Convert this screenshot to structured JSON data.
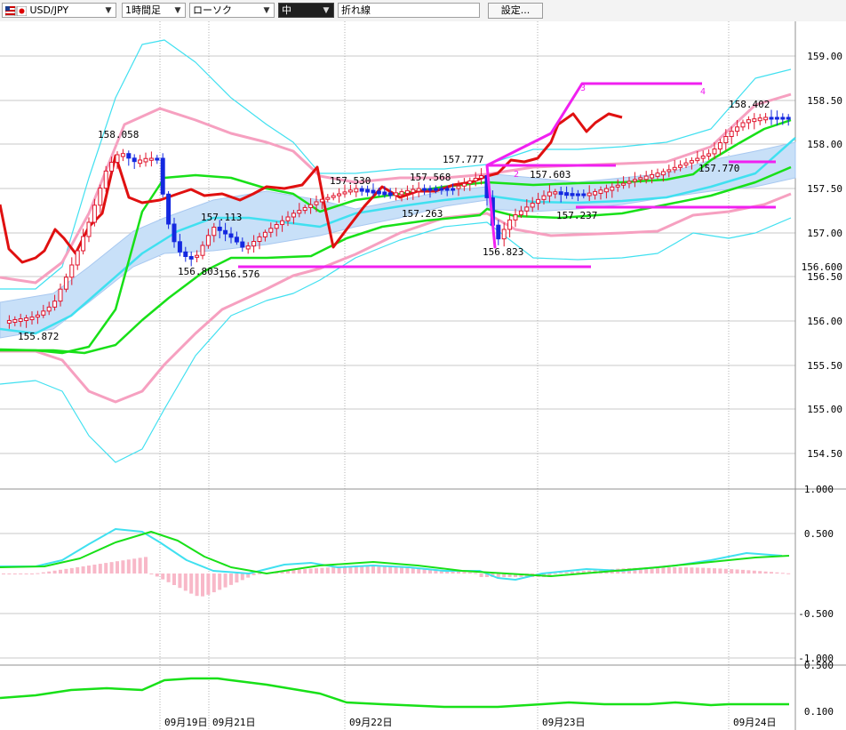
{
  "toolbar": {
    "symbol": "USD/JPY",
    "timeframe": "1時間足",
    "chart_style": "ローソク",
    "size": "中",
    "line_type": "折れ線",
    "settings_label": "設定..."
  },
  "colors": {
    "bg": "#ffffff",
    "grid_solid": "#c8c8c8",
    "grid_dotted": "#b0b0b0",
    "candle_up": "#e0142c",
    "candle_down": "#1428e0",
    "bb_outer": "#40e0f0",
    "bb_inner": "#f6a0c0",
    "ma_green": "#18e018",
    "cloud": "#c8e0f8",
    "red_line": "#e01010",
    "magenta": "#f020f0",
    "histogram": "#f8b8c8"
  },
  "price_axis": {
    "ticks": [
      "159.00",
      "158.50",
      "158.00",
      "157.50",
      "157.00",
      "156.600",
      "156.50",
      "156.00",
      "155.50",
      "155.00",
      "154.50"
    ]
  },
  "macd_axis": {
    "ticks": [
      "1.000",
      "0.500",
      "-0.500",
      "-1.000"
    ]
  },
  "adx_axis": {
    "ticks": [
      "0.500",
      "0.100"
    ]
  },
  "date_labels": [
    "09月19日",
    "09月21日",
    "09月22日",
    "09月23日",
    "09月24日"
  ],
  "price_labels": [
    "158.058",
    "155.872",
    "157.113",
    "156.803",
    "156.576",
    "157.530",
    "157.568",
    "157.263",
    "157.777",
    "156.823",
    "157.603",
    "157.237",
    "158.402",
    "157.770"
  ],
  "wave_labels": [
    "2",
    "3",
    "4"
  ],
  "chart_data": {
    "type": "candlestick",
    "symbol": "USD/JPY",
    "timeframe": "1時間足",
    "ylim": [
      154.3,
      159.2
    ],
    "x_labels": [
      "09月19日",
      "09月21日",
      "09月22日",
      "09月23日",
      "09月24日"
    ],
    "marked_highs": [
      158.058,
      157.113,
      157.53,
      157.568,
      157.777,
      157.603,
      158.402
    ],
    "marked_lows": [
      155.872,
      156.803,
      156.576,
      157.263,
      156.823,
      157.237,
      157.77
    ],
    "horizontal_lines": [
      156.6,
      157.77,
      157.3,
      158.7
    ],
    "macd_ylim": [
      -1.0,
      1.0
    ],
    "adx_ylim": [
      0.1,
      0.5
    ]
  }
}
